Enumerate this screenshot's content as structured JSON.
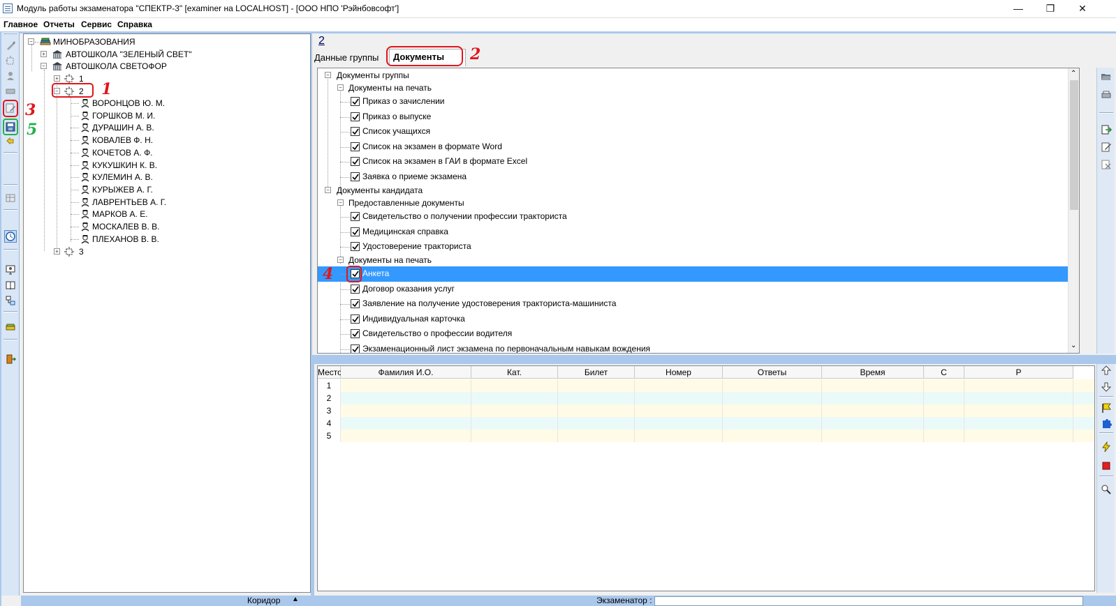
{
  "window": {
    "title": "Модуль работы экзаменатора \"СПЕКТР-3\" [examiner на LOCALHOST] - [ООО НПО 'Рэйнбовсофт']",
    "minimize": "—",
    "restore": "❐",
    "close": "✕"
  },
  "menu": [
    "Главное",
    "Отчеты",
    "Сервис",
    "Справка"
  ],
  "tree": {
    "root": "МИНОБРАЗОВАНИЯ",
    "school1": "АВТОШКОЛА \"ЗЕЛЕНЫЙ СВЕТ\"",
    "school2": "АВТОШКОЛА СВЕТОФОР",
    "group1": "1",
    "group2": "2",
    "group3": "3",
    "people": [
      "ВОРОНЦОВ Ю. М.",
      "ГОРШКОВ М. И.",
      "ДУРАШИН А. В.",
      "КОВАЛЕВ Ф. Н.",
      "КОЧЕТОВ А. Ф.",
      "КУКУШКИН К. В.",
      "КУЛЕМИН А. В.",
      "КУРЫЖЕВ А. Г.",
      "ЛАВРЕНТЬЕВ А. Г.",
      "МАРКОВ А. Е.",
      "МОСКАЛЕВ В. В.",
      "ПЛЕХАНОВ В. В."
    ]
  },
  "right": {
    "group_title": "2",
    "tabs": [
      "Данные группы",
      "Документы"
    ],
    "docs": {
      "group_docs": "Документы группы",
      "print_docs": "Документы на печать",
      "group_items": [
        "Приказ о зачислении",
        "Приказ о выпуске",
        "Список учащихся",
        "Список на экзамен в формате Word",
        "Список на экзамен в ГАИ в формате Excel",
        "Заявка о приеме экзамена"
      ],
      "candidate_docs": "Документы кандидата",
      "provided_docs": "Предоставленные документы",
      "provided_items": [
        "Свидетельство о получении профессии тракториста",
        "Медицинская справка",
        "Удостоверение тракториста"
      ],
      "print_docs2": "Документы на печать",
      "candidate_print_items": [
        "Анкета",
        "Договор оказания услуг",
        "Заявление на получение удостоверения тракториста-машиниста",
        "Индивидуальная карточка",
        "Свидетельство о профессии водителя",
        "Экзаменационный лист экзамена по первоначальным навыкам вождения"
      ],
      "selected_item": "Анкета"
    }
  },
  "grid": {
    "headers": [
      "Место",
      "Фамилия И.О.",
      "Кат.",
      "Билет",
      "Номер",
      "Ответы",
      "Время",
      "С",
      "Р"
    ],
    "rows": [
      "1",
      "2",
      "3",
      "4",
      "5"
    ]
  },
  "status": {
    "corridor": "Коридор",
    "examiner": "Экзаменатор :"
  },
  "annotations": [
    "1",
    "2",
    "3",
    "4",
    "5"
  ],
  "colors": {
    "selection": "#3399ff",
    "annotation_red": "#e0161c",
    "annotation_green": "#22b14c",
    "frame_blue": "#aac8ec"
  }
}
